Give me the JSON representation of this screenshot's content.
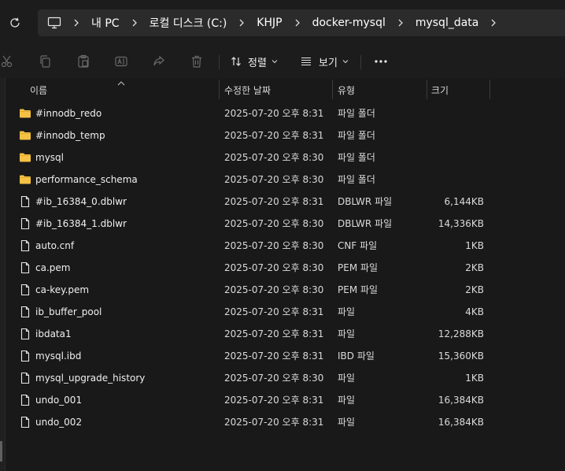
{
  "address_bar": {
    "crumbs": [
      "내 PC",
      "로컬 디스크 (C:)",
      "KHJP",
      "docker-mysql",
      "mysql_data"
    ]
  },
  "toolbar": {
    "sort_label": "정렬",
    "view_label": "보기"
  },
  "columns": {
    "name": "이름",
    "date": "수정한 날짜",
    "type": "유형",
    "size": "크기"
  },
  "files": [
    {
      "name": "#innodb_redo",
      "date": "2025-07-20 오후 8:31",
      "type": "파일 폴더",
      "size": "",
      "kind": "folder"
    },
    {
      "name": "#innodb_temp",
      "date": "2025-07-20 오후 8:31",
      "type": "파일 폴더",
      "size": "",
      "kind": "folder"
    },
    {
      "name": "mysql",
      "date": "2025-07-20 오후 8:30",
      "type": "파일 폴더",
      "size": "",
      "kind": "folder"
    },
    {
      "name": "performance_schema",
      "date": "2025-07-20 오후 8:30",
      "type": "파일 폴더",
      "size": "",
      "kind": "folder"
    },
    {
      "name": "#ib_16384_0.dblwr",
      "date": "2025-07-20 오후 8:31",
      "type": "DBLWR 파일",
      "size": "6,144KB",
      "kind": "file"
    },
    {
      "name": "#ib_16384_1.dblwr",
      "date": "2025-07-20 오후 8:30",
      "type": "DBLWR 파일",
      "size": "14,336KB",
      "kind": "file"
    },
    {
      "name": "auto.cnf",
      "date": "2025-07-20 오후 8:30",
      "type": "CNF 파일",
      "size": "1KB",
      "kind": "file"
    },
    {
      "name": "ca.pem",
      "date": "2025-07-20 오후 8:30",
      "type": "PEM 파일",
      "size": "2KB",
      "kind": "file"
    },
    {
      "name": "ca-key.pem",
      "date": "2025-07-20 오후 8:30",
      "type": "PEM 파일",
      "size": "2KB",
      "kind": "file"
    },
    {
      "name": "ib_buffer_pool",
      "date": "2025-07-20 오후 8:31",
      "type": "파일",
      "size": "4KB",
      "kind": "file"
    },
    {
      "name": "ibdata1",
      "date": "2025-07-20 오후 8:31",
      "type": "파일",
      "size": "12,288KB",
      "kind": "file"
    },
    {
      "name": "mysql.ibd",
      "date": "2025-07-20 오후 8:31",
      "type": "IBD 파일",
      "size": "15,360KB",
      "kind": "file"
    },
    {
      "name": "mysql_upgrade_history",
      "date": "2025-07-20 오후 8:30",
      "type": "파일",
      "size": "1KB",
      "kind": "file"
    },
    {
      "name": "undo_001",
      "date": "2025-07-20 오후 8:31",
      "type": "파일",
      "size": "16,384KB",
      "kind": "file"
    },
    {
      "name": "undo_002",
      "date": "2025-07-20 오후 8:31",
      "type": "파일",
      "size": "16,384KB",
      "kind": "file"
    }
  ],
  "icons": {
    "refresh": "refresh-icon",
    "pc": "computer-icon",
    "cut": "cut-icon",
    "copy": "copy-icon",
    "paste": "paste-icon",
    "rename": "rename-icon",
    "share": "share-icon",
    "delete": "delete-icon",
    "sort": "sort-icon",
    "view": "view-icon",
    "more": "more-icon",
    "folder": "folder-icon",
    "file": "file-icon"
  },
  "colors": {
    "background": "#191919",
    "folder": "#f4c145",
    "text": "#f0f0f0"
  }
}
